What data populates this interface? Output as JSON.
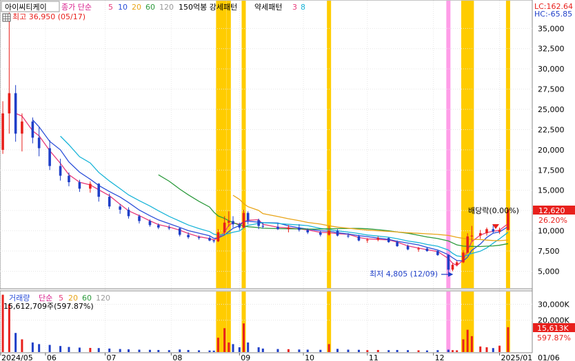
{
  "header": {
    "stock_name": "아이씨티케이",
    "ma_label": "종가 단순",
    "ma_periods": [
      "5",
      "10",
      "20",
      "60",
      "120"
    ],
    "pattern_label": "150억봉 강세패턴",
    "weak_label": "약세패턴",
    "weak_counts": [
      "3",
      "8"
    ],
    "lc": "LC:162.64",
    "hc": "HC:-65.85"
  },
  "annotations": {
    "high": "최고 36,950 (05/17)",
    "low": "최저 4,805 (12/09)",
    "dividend": "배당락(0.00%)"
  },
  "price_axis": {
    "ticks": [
      "35,000",
      "32,500",
      "30,000",
      "27,500",
      "25,000",
      "22,500",
      "20,000",
      "17,500",
      "15,000",
      "12,500",
      "10,000",
      "7,500",
      "5,000"
    ],
    "current_price": "12,620",
    "current_pct": "26.20%"
  },
  "volume_panel": {
    "title": "거래량",
    "ma_label": "단순",
    "ma_periods": [
      "5",
      "20",
      "60",
      "120"
    ],
    "current": "15,612,709주(597.87%)",
    "ticks": [
      "30,000K",
      "20,000K"
    ],
    "current_value": "15,613K",
    "current_pct": "597.87%"
  },
  "x_axis": {
    "labels": [
      "2024/05",
      "06",
      "07",
      "08",
      "09",
      "10",
      "11",
      "12",
      "2025/01",
      "01/06"
    ]
  },
  "colors": {
    "up": "#e8201c",
    "down": "#1f3fc8",
    "ma5": "#e83a7a",
    "ma10": "#2a4ed8",
    "ma20": "#18b4d8",
    "ma60": "#2c9a3c",
    "ma120": "#e8a418",
    "strong_highlight": "#ffcc00",
    "weak_highlight": "#ff9de8"
  },
  "chart_data": {
    "type": "candlestick",
    "price_range": [
      3000,
      38000
    ],
    "volume_range_k": [
      0,
      38000
    ],
    "highlights": {
      "strong": [
        [
          "2024-08-23",
          "2024-08-26"
        ],
        [
          "2024-08-28",
          "2024-08-28"
        ],
        [
          "2024-09-04",
          "2024-09-04"
        ],
        [
          "2024-10-14",
          "2024-10-14"
        ],
        [
          "2024-12-16",
          "2024-12-20"
        ],
        [
          "2025-01-06",
          "2025-01-06"
        ]
      ],
      "weak": [
        [
          "2024-12-09",
          "2024-12-09"
        ]
      ]
    },
    "ohlcv": [
      [
        "2024-05-14",
        20000,
        26000,
        19500,
        24500,
        36000
      ],
      [
        "2024-05-17",
        24500,
        36950,
        22000,
        27000,
        30000
      ],
      [
        "2024-05-20",
        27000,
        28000,
        21000,
        22000,
        12000
      ],
      [
        "2024-05-23",
        22000,
        24500,
        19800,
        23500,
        8000
      ],
      [
        "2024-05-28",
        23500,
        24000,
        20800,
        21500,
        6000
      ],
      [
        "2024-05-31",
        21500,
        22800,
        19200,
        20200,
        5000
      ],
      [
        "2024-06-05",
        20200,
        21200,
        17500,
        18000,
        4500
      ],
      [
        "2024-06-10",
        18000,
        18900,
        16200,
        16800,
        3800
      ],
      [
        "2024-06-14",
        16800,
        17200,
        15500,
        16000,
        3200
      ],
      [
        "2024-06-19",
        16000,
        16300,
        14800,
        15200,
        2800
      ],
      [
        "2024-06-24",
        15200,
        16100,
        14700,
        15800,
        2600
      ],
      [
        "2024-06-28",
        15800,
        15900,
        13600,
        14200,
        2500
      ],
      [
        "2024-07-03",
        14200,
        14600,
        12700,
        13000,
        2200
      ],
      [
        "2024-07-08",
        13000,
        13300,
        12100,
        12600,
        1900
      ],
      [
        "2024-07-12",
        12600,
        12900,
        11500,
        11800,
        1700
      ],
      [
        "2024-07-17",
        11800,
        12000,
        10900,
        11200,
        1500
      ],
      [
        "2024-07-22",
        11200,
        11400,
        10500,
        10700,
        1400
      ],
      [
        "2024-07-26",
        10700,
        10900,
        10200,
        10400,
        1300
      ],
      [
        "2024-07-31",
        10400,
        10700,
        10100,
        10300,
        1200
      ],
      [
        "2024-08-05",
        10300,
        10400,
        9300,
        9500,
        1600
      ],
      [
        "2024-08-09",
        9500,
        9800,
        9000,
        9200,
        1300
      ],
      [
        "2024-08-14",
        9200,
        9400,
        8900,
        9100,
        1100
      ],
      [
        "2024-08-19",
        9100,
        9300,
        8700,
        8800,
        1000
      ],
      [
        "2024-08-21",
        8800,
        8900,
        8500,
        8700,
        900
      ],
      [
        "2024-08-23",
        8700,
        10200,
        8600,
        9800,
        9000
      ],
      [
        "2024-08-26",
        9800,
        11800,
        9500,
        11000,
        15000
      ],
      [
        "2024-08-28",
        11000,
        12400,
        10500,
        11200,
        6000
      ],
      [
        "2024-08-30",
        11200,
        11800,
        10400,
        10800,
        5000
      ],
      [
        "2024-09-02",
        10800,
        11000,
        10100,
        10400,
        3000
      ],
      [
        "2024-09-04",
        10400,
        12600,
        10300,
        12200,
        18000
      ],
      [
        "2024-09-06",
        12200,
        12400,
        10800,
        11300,
        6000
      ],
      [
        "2024-09-11",
        11300,
        11500,
        10200,
        10600,
        3000
      ],
      [
        "2024-09-13",
        10600,
        11000,
        10300,
        10500,
        2200
      ],
      [
        "2024-09-20",
        10500,
        10900,
        10100,
        10200,
        1900
      ],
      [
        "2024-09-25",
        10200,
        10700,
        9800,
        10400,
        1800
      ],
      [
        "2024-09-30",
        10400,
        10800,
        9900,
        10100,
        1600
      ],
      [
        "2024-10-04",
        10100,
        10300,
        9600,
        9800,
        1500
      ],
      [
        "2024-10-10",
        9800,
        10000,
        9300,
        9500,
        1400
      ],
      [
        "2024-10-14",
        9500,
        10600,
        9400,
        10000,
        5000
      ],
      [
        "2024-10-18",
        10000,
        10200,
        9300,
        9400,
        2000
      ],
      [
        "2024-10-23",
        9400,
        9700,
        9100,
        9300,
        1500
      ],
      [
        "2024-10-28",
        9300,
        9500,
        8700,
        8800,
        1400
      ],
      [
        "2024-11-01",
        8800,
        9100,
        8500,
        8900,
        1200
      ],
      [
        "2024-11-06",
        8900,
        9300,
        8700,
        9100,
        1300
      ],
      [
        "2024-11-11",
        9100,
        9200,
        8500,
        8600,
        1200
      ],
      [
        "2024-11-15",
        8600,
        8800,
        8000,
        8100,
        1300
      ],
      [
        "2024-11-20",
        8100,
        8300,
        7600,
        7700,
        1200
      ],
      [
        "2024-11-25",
        7700,
        8000,
        7400,
        7800,
        1100
      ],
      [
        "2024-11-29",
        7800,
        8000,
        7400,
        7500,
        1000
      ],
      [
        "2024-12-04",
        7500,
        7600,
        6900,
        7000,
        1200
      ],
      [
        "2024-12-09",
        7000,
        7100,
        4805,
        5200,
        1500
      ],
      [
        "2024-12-11",
        5200,
        6000,
        5000,
        5800,
        1200
      ],
      [
        "2024-12-13",
        5800,
        6300,
        5600,
        6100,
        1100
      ],
      [
        "2024-12-16",
        6100,
        7600,
        6000,
        7300,
        8000
      ],
      [
        "2024-12-18",
        7300,
        9700,
        7200,
        9300,
        14000
      ],
      [
        "2024-12-20",
        9300,
        10600,
        8700,
        9400,
        10000
      ],
      [
        "2024-12-24",
        9400,
        10100,
        9000,
        9700,
        3500
      ],
      [
        "2024-12-27",
        9700,
        10400,
        9400,
        10200,
        3000
      ],
      [
        "2024-12-30",
        10200,
        10700,
        9700,
        9900,
        2500
      ],
      [
        "2025-01-02",
        9900,
        10400,
        9600,
        10100,
        4000
      ],
      [
        "2025-01-06",
        10100,
        12900,
        10000,
        12620,
        15613
      ]
    ]
  }
}
